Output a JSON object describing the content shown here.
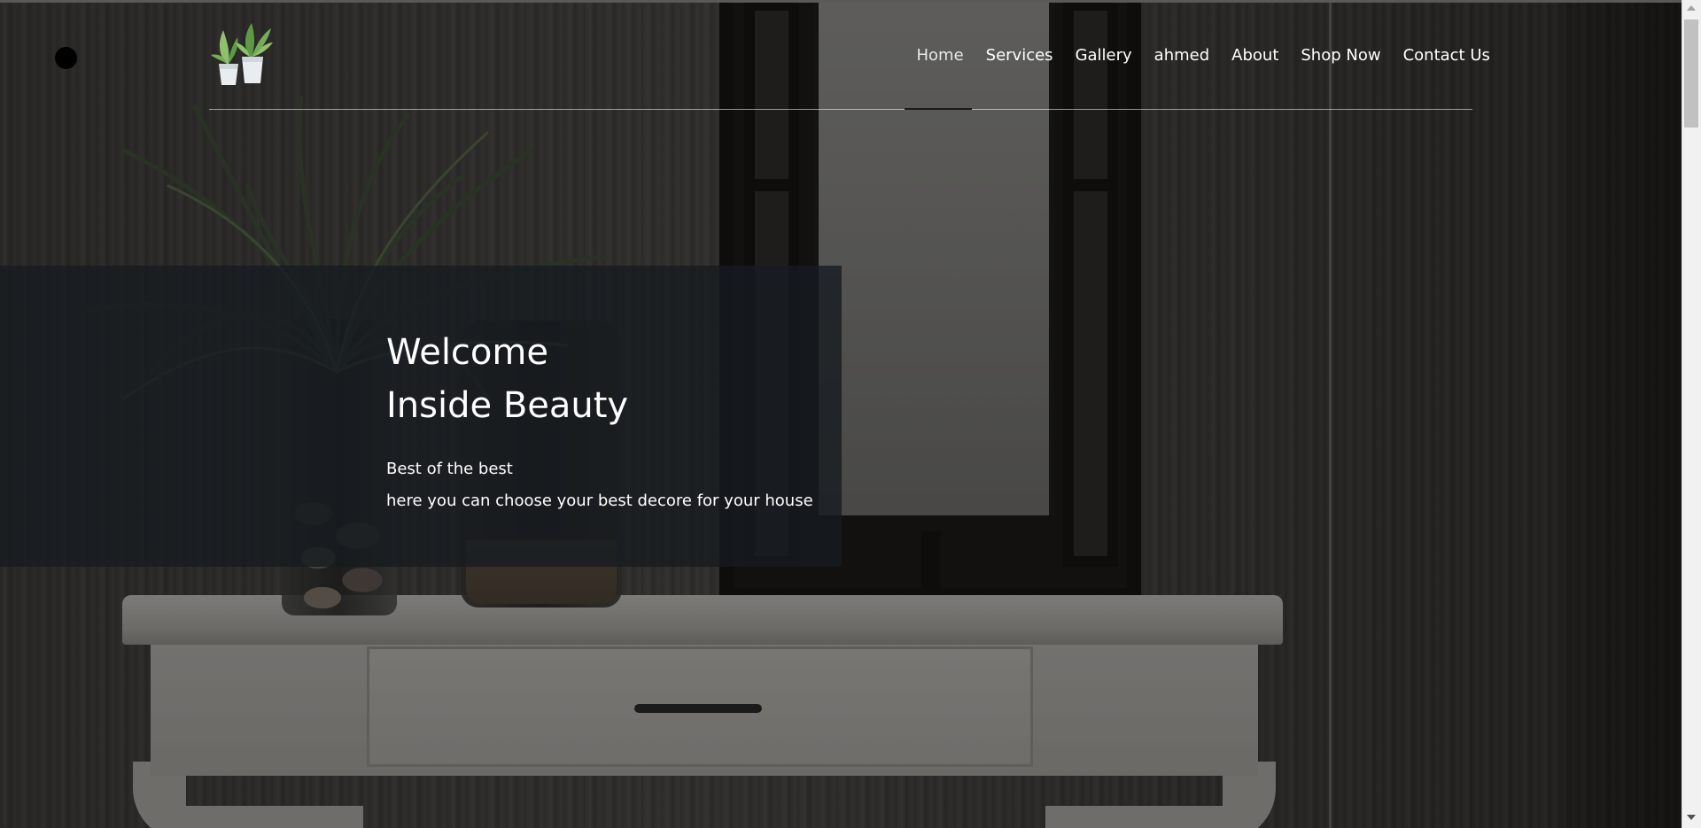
{
  "nav": {
    "items": [
      {
        "label": "Home",
        "active": true
      },
      {
        "label": "Services",
        "active": false
      },
      {
        "label": "Gallery",
        "active": false
      },
      {
        "label": "ahmed",
        "active": false
      },
      {
        "label": "About",
        "active": false
      },
      {
        "label": "Shop Now",
        "active": false
      },
      {
        "label": "Contact Us",
        "active": false
      }
    ]
  },
  "hero": {
    "title_line1": "Welcome",
    "title_line2": "Inside Beauty",
    "subtitle_line1": "Best of the best",
    "subtitle_line2": "here you can choose your best decore for your house"
  },
  "colors": {
    "panel": "#161b21",
    "text": "#ffffff",
    "dot": "#000000"
  },
  "icons": {
    "logo": "potted-plants-logo",
    "dot": "menu-dot-icon"
  }
}
